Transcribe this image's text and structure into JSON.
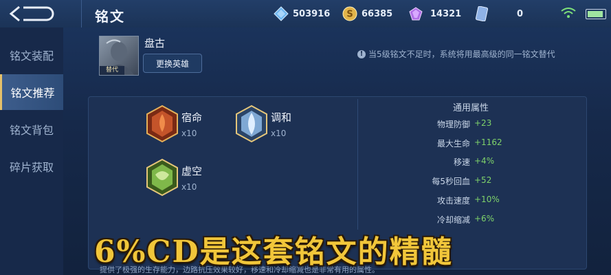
{
  "header": {
    "title": "铭文",
    "currencies": [
      {
        "icon": "diamond-icon",
        "value": "503916"
      },
      {
        "icon": "gold-coin-icon",
        "value": "66385"
      },
      {
        "icon": "crystal-icon",
        "value": "14321"
      },
      {
        "icon": "card-icon",
        "value": "0"
      }
    ]
  },
  "sidebar": {
    "items": [
      {
        "label": "铭文装配",
        "active": false
      },
      {
        "label": "铭文推荐",
        "active": true
      },
      {
        "label": "铭文背包",
        "active": false
      },
      {
        "label": "碎片获取",
        "active": false
      }
    ]
  },
  "hero": {
    "avatar_badge": "替代",
    "name": "盘古",
    "change_button": "更换英雄",
    "tip": "当5级铭文不足时，系统将用最高级的同一铭文替代"
  },
  "runes": [
    {
      "name": "宿命",
      "count": "x10",
      "color": "#c4542a",
      "icon": "red-rune-icon"
    },
    {
      "name": "调和",
      "count": "x10",
      "color": "#7fa8d4",
      "icon": "blue-rune-icon"
    },
    {
      "name": "虚空",
      "count": "x10",
      "color": "#7fb84a",
      "icon": "green-rune-icon"
    }
  ],
  "attributes": {
    "title": "通用属性",
    "rows": [
      {
        "name": "物理防御",
        "value": "+23"
      },
      {
        "name": "最大生命",
        "value": "+1162"
      },
      {
        "name": "移速",
        "value": "+4%"
      },
      {
        "name": "每5秒回血",
        "value": "+52"
      },
      {
        "name": "攻击速度",
        "value": "+10%"
      },
      {
        "name": "冷却缩减",
        "value": "+6%"
      }
    ]
  },
  "overlay_caption": "6%CD是这套铭文的精髓",
  "bottom_text": "提供了极强的生存能力，边路抗压效果较好，移速和冷却缩减也是非常有用的属性。",
  "colors": {
    "accent_gold": "#e6c16a",
    "value_green": "#7fd36a",
    "caption_yellow": "#f1c63a"
  }
}
